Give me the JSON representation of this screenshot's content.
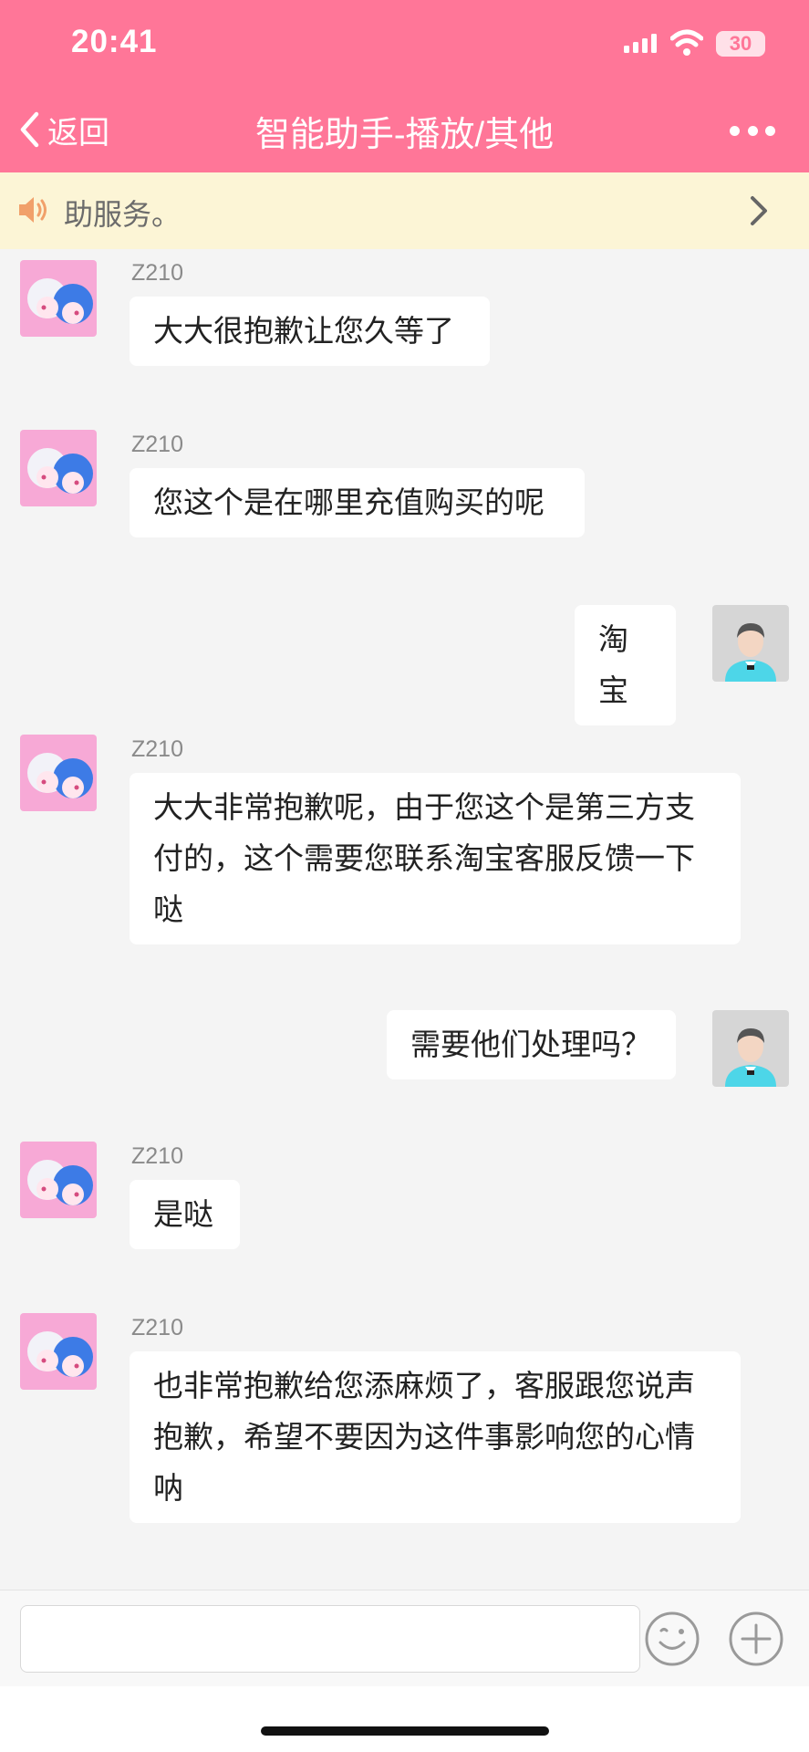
{
  "status_bar": {
    "time": "20:41",
    "battery": "30",
    "icons": [
      "signal-icon",
      "wifi-icon",
      "battery-icon"
    ]
  },
  "nav": {
    "back_label": "返回",
    "title": "智能助手-播放/其他",
    "more_icon": "more-icon"
  },
  "notice": {
    "icon": "speaker-icon",
    "text": "助服务。",
    "chevron_icon": "chevron-right-icon"
  },
  "messages": [
    {
      "side": "left",
      "sender": "Z210",
      "text": "大大很抱歉让您久等了"
    },
    {
      "side": "left",
      "sender": "Z210",
      "text": "您这个是在哪里充值购买的呢"
    },
    {
      "side": "right",
      "text": "淘宝"
    },
    {
      "side": "left",
      "sender": "Z210",
      "text": "大大非常抱歉呢，由于您这个是第三方支付的，这个需要您联系淘宝客服反馈一下哒"
    },
    {
      "side": "right",
      "text": "需要他们处理吗？"
    },
    {
      "side": "left",
      "sender": "Z210",
      "text": "是哒"
    },
    {
      "side": "left",
      "sender": "Z210",
      "text": "也非常抱歉给您添麻烦了，客服跟您说声抱歉，希望不要因为这件事影响您的心情呐"
    }
  ],
  "input_bar": {
    "placeholder": "",
    "emoji_icon": "emoji-icon",
    "plus_icon": "plus-icon"
  },
  "colors": {
    "header": "#ff7698",
    "notice_bg": "#fcf5d6",
    "chat_bg": "#f4f4f4",
    "bubble": "#ffffff"
  }
}
